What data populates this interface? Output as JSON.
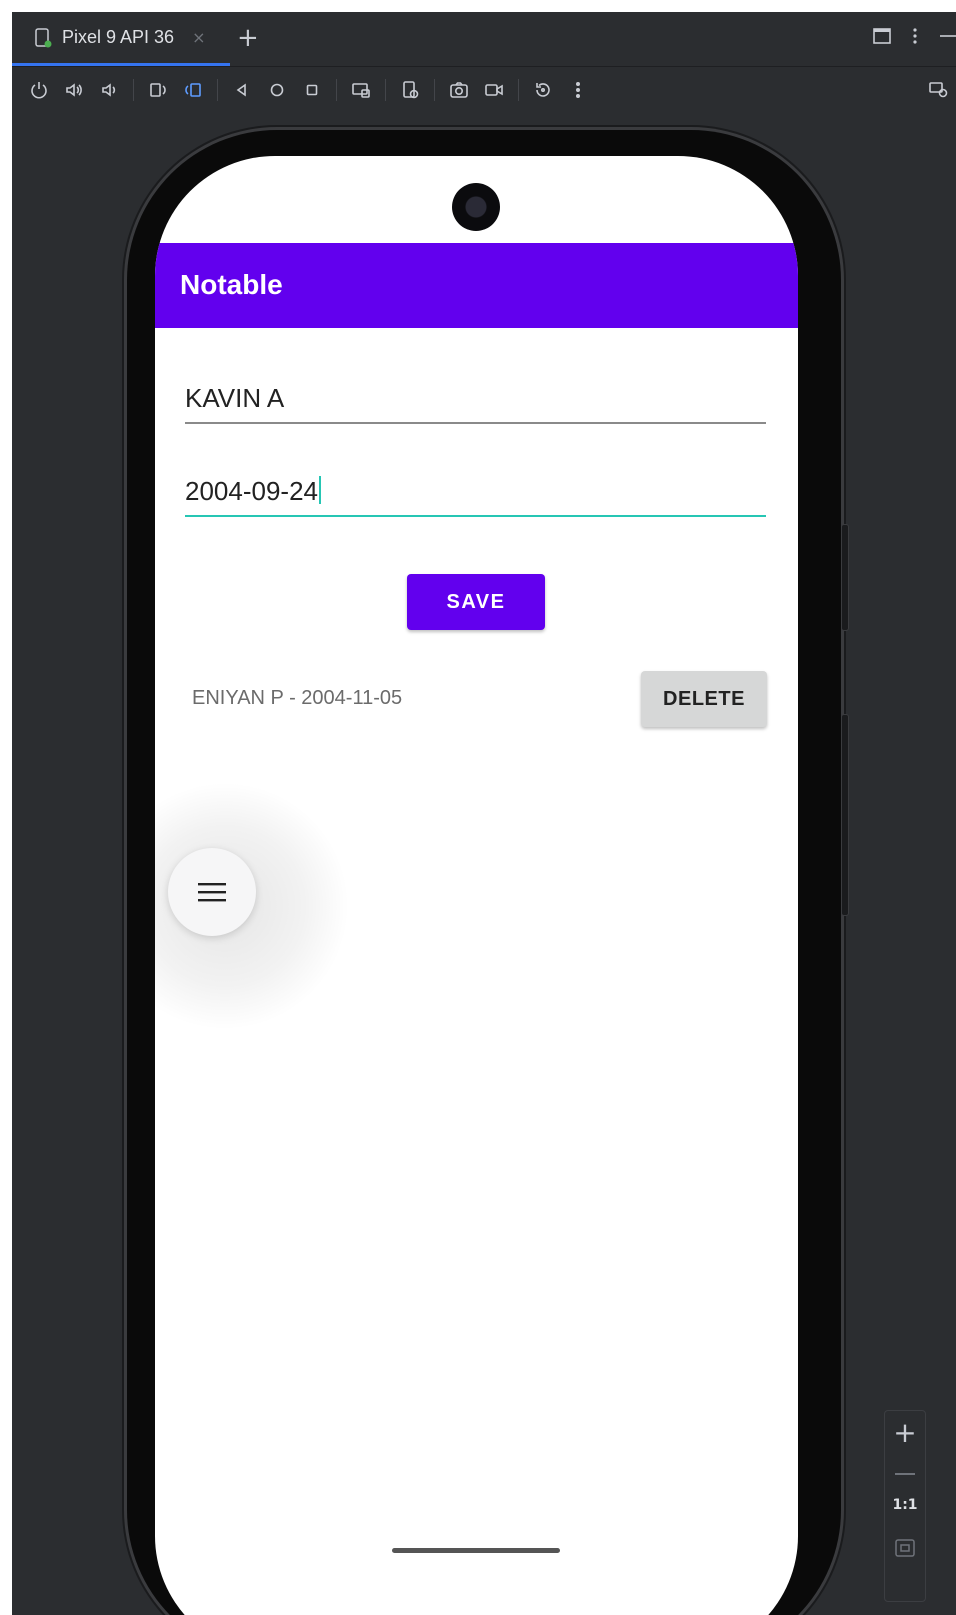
{
  "window": {
    "tab_title": "Pixel 9 API 36",
    "tab_close": "×",
    "tab_add": "+",
    "controls": [
      "maximize-icon",
      "more-vert-icon",
      "minimize-icon"
    ]
  },
  "toolbar": {
    "icons": [
      "power-icon",
      "volume-up-icon",
      "volume-down-icon",
      "rotate-left-icon",
      "rotate-right-icon",
      "back-icon",
      "home-icon",
      "overview-icon",
      "fold-icon",
      "screen-record-icon",
      "camera-icon",
      "video-icon",
      "reset-icon",
      "more-icon",
      "device-mirror-icon"
    ]
  },
  "app": {
    "title": "Notable",
    "name_value": "KAVIN A",
    "date_value": "2004-09-24",
    "save_label": "SAVE",
    "notes": [
      {
        "text": "ENIYAN P - 2004-11-05",
        "delete_label": "DELETE"
      }
    ],
    "accent_color": "#6200ee",
    "focus_color": "#26c6b4"
  },
  "zoom": {
    "label": "1:1",
    "zoom_in": "+"
  }
}
